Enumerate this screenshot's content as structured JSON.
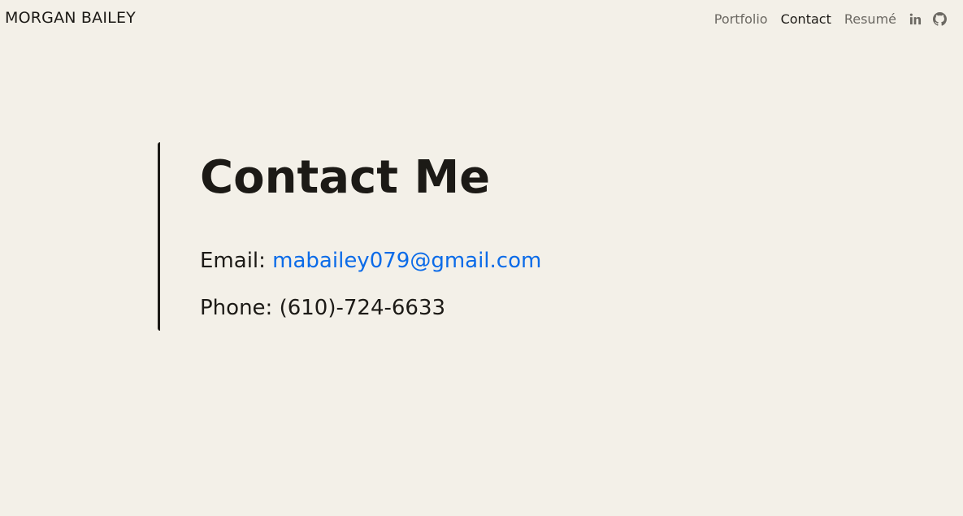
{
  "header": {
    "brand": "MORGAN BAILEY",
    "nav": {
      "portfolio": "Portfolio",
      "contact": "Contact",
      "resume": "Resumé",
      "linkedin_icon": "linkedin-icon",
      "github_icon": "github-icon"
    }
  },
  "main": {
    "title": "Contact Me",
    "email_label": "Email:",
    "email_value": "mabailey079@gmail.com",
    "phone_label": "Phone:",
    "phone_value": "(610)-724-6633"
  },
  "colors": {
    "background": "#f3f0e8",
    "text": "#1c1a16",
    "muted": "#6b6862",
    "link": "#0b6be8"
  }
}
